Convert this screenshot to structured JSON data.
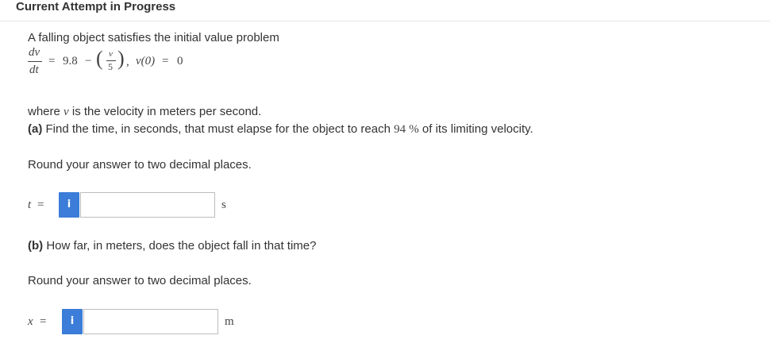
{
  "header": {
    "title": "Current Attempt in Progress"
  },
  "problem": {
    "intro": "A falling object satisfies the initial value problem",
    "equation": {
      "lhs_num": "dv",
      "lhs_den": "dt",
      "equals": "=",
      "constant": "9.8",
      "minus": "−",
      "inner_num": "v",
      "inner_den": "5",
      "comma": ",",
      "initial": "v(0)",
      "initial_equals": "=",
      "initial_value": "0"
    },
    "where_pre": "where ",
    "where_var": "v",
    "where_post": " is the velocity in meters per second."
  },
  "part_a": {
    "label": "(a)",
    "question_pre": " Find the time, in seconds, that must elapse for the object to reach ",
    "percent_value": "94",
    "percent_sign": "%",
    "question_post": " of its limiting velocity.",
    "round_note": "Round your answer to two decimal places.",
    "var_label": "t",
    "equals": "=",
    "info_icon_glyph": "i",
    "input_value": "",
    "unit": "s"
  },
  "part_b": {
    "label": "(b)",
    "question": " How far, in meters, does the object fall in that time?",
    "round_note": "Round your answer to two decimal places.",
    "var_label": "x",
    "equals": "=",
    "info_icon_glyph": "i",
    "input_value": "",
    "unit": "m"
  },
  "colors": {
    "info_button": "#3b7dd8",
    "text": "#333333",
    "input_border": "#bdbdbd"
  }
}
